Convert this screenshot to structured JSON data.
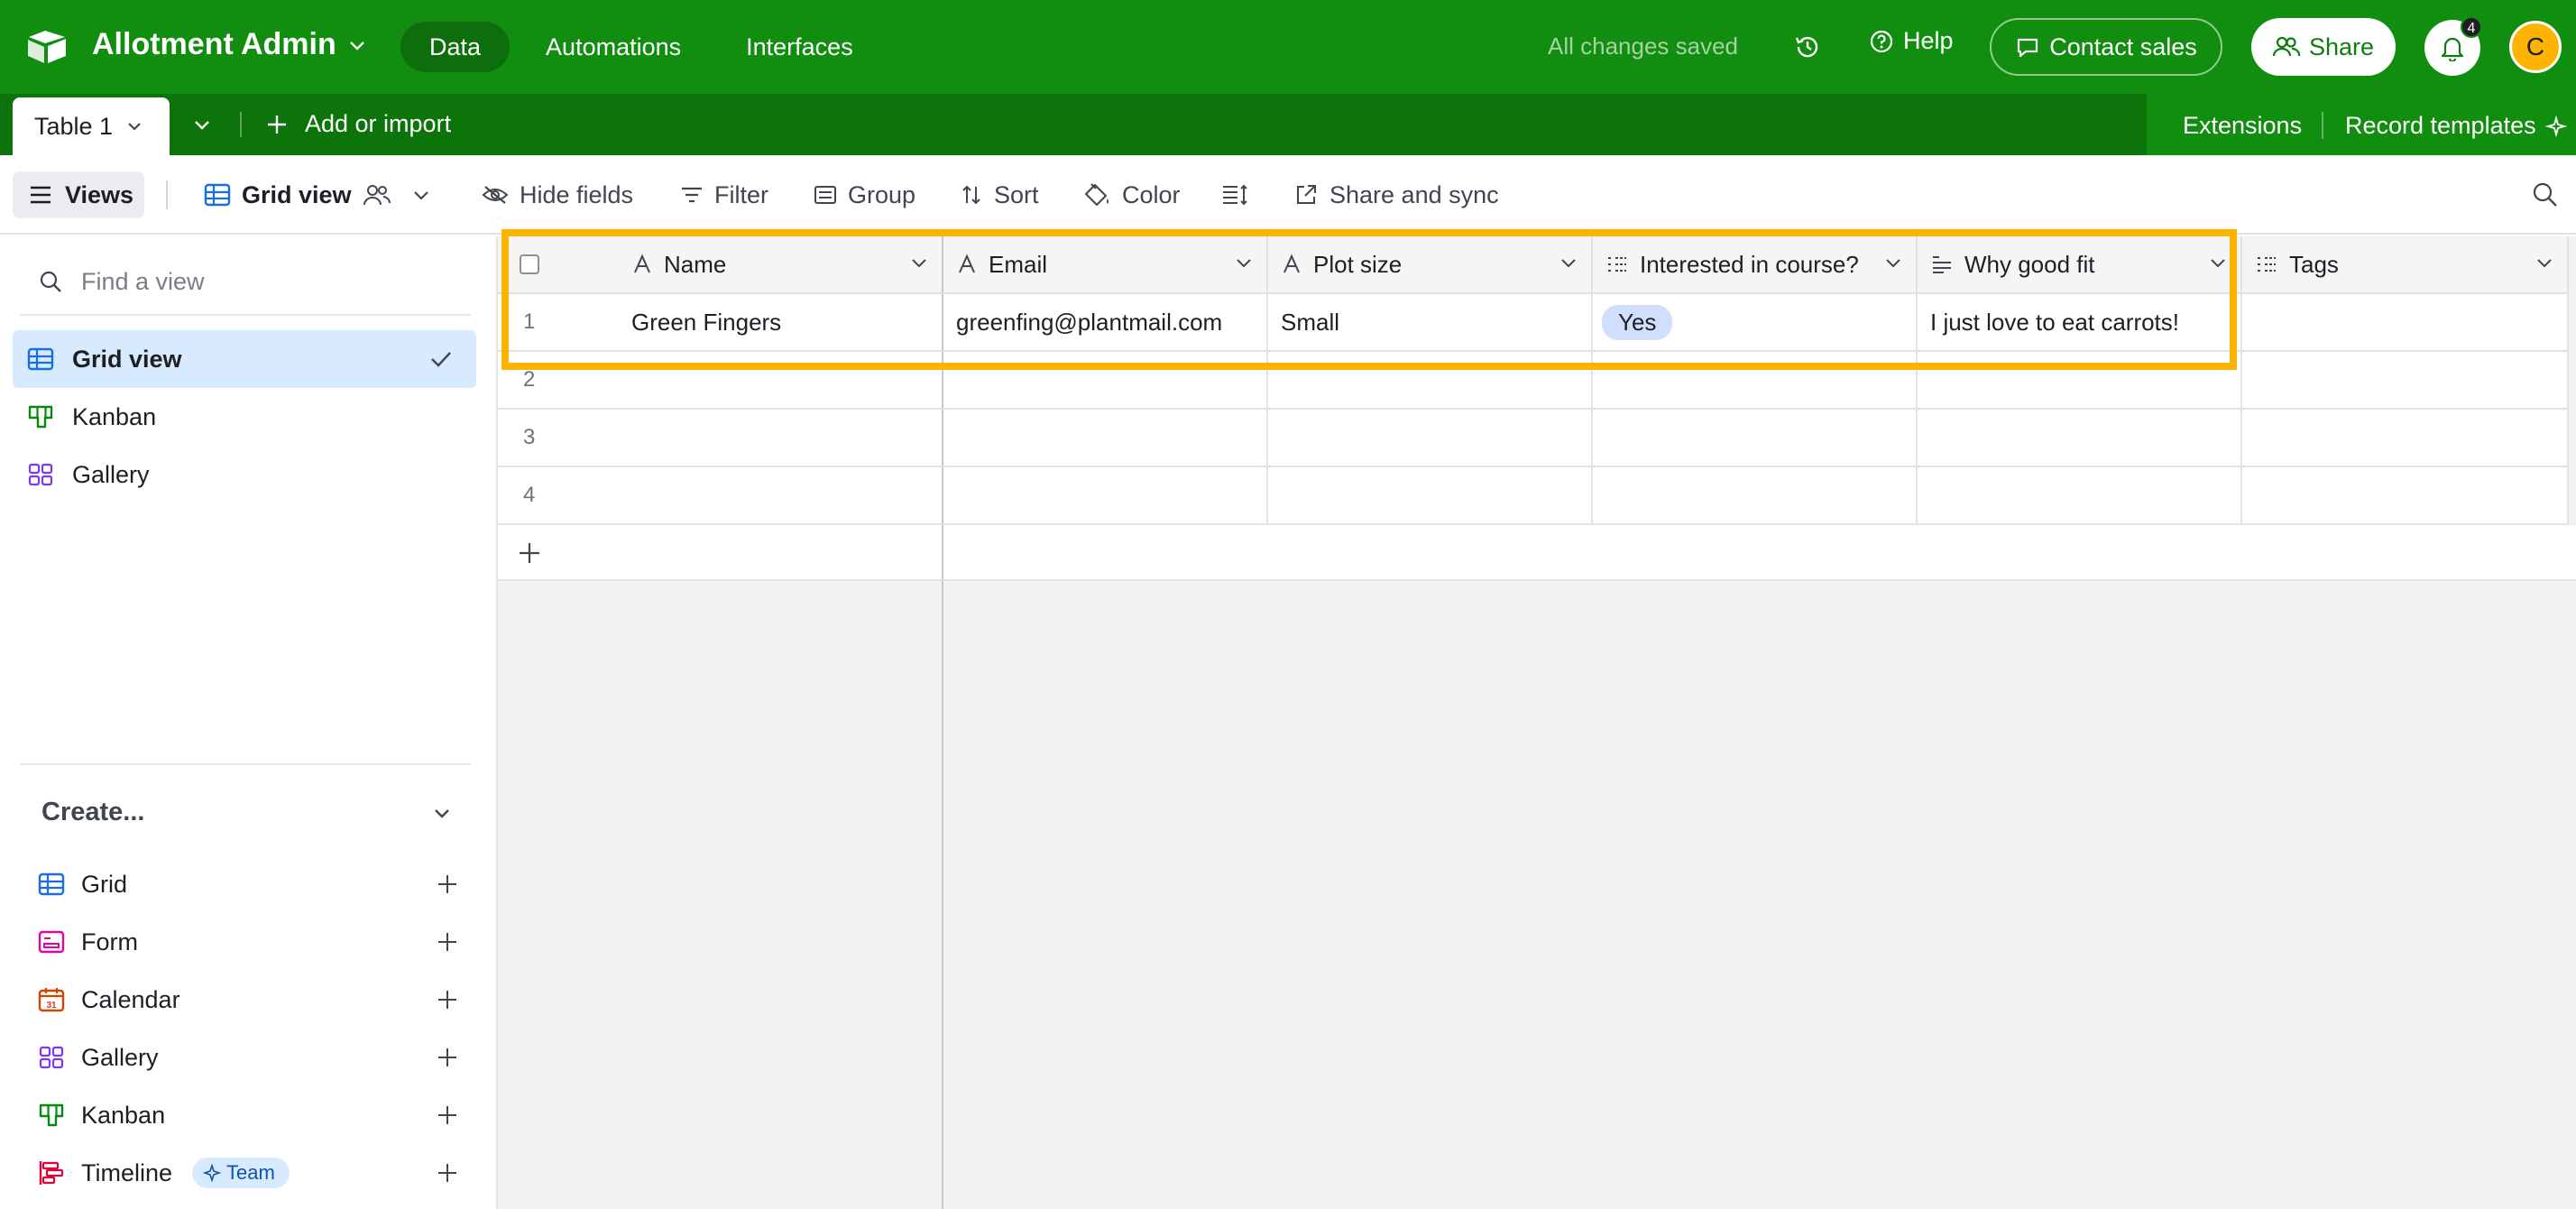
{
  "topbar": {
    "base_name": "Allotment Admin",
    "nav": [
      "Data",
      "Automations",
      "Interfaces"
    ],
    "active_nav": "Data",
    "save_status": "All changes saved",
    "help_label": "Help",
    "contact_label": "Contact sales",
    "share_label": "Share",
    "notification_count": "4",
    "avatar_initial": "C",
    "avatar_color": "#fcb400",
    "brand_color": "#118d0f"
  },
  "tabbar": {
    "table_tab": "Table 1",
    "add_import_label": "Add or import",
    "extensions_label": "Extensions",
    "record_templates_label": "Record templates"
  },
  "viewbar": {
    "views_label": "Views",
    "current_view": "Grid view",
    "hide_fields": "Hide fields",
    "filter": "Filter",
    "group": "Group",
    "sort": "Sort",
    "color": "Color",
    "share_sync": "Share and sync"
  },
  "sidebar": {
    "search_placeholder": "Find a view",
    "views": [
      {
        "label": "Grid view",
        "icon": "grid-icon",
        "active": true
      },
      {
        "label": "Kanban",
        "icon": "kanban-icon"
      },
      {
        "label": "Gallery",
        "icon": "gallery-icon"
      }
    ],
    "create_label": "Create...",
    "create_items": [
      {
        "label": "Grid",
        "icon": "grid-icon"
      },
      {
        "label": "Form",
        "icon": "form-icon"
      },
      {
        "label": "Calendar",
        "icon": "calendar-icon"
      },
      {
        "label": "Gallery",
        "icon": "gallery-icon"
      },
      {
        "label": "Kanban",
        "icon": "kanban-icon"
      },
      {
        "label": "Timeline",
        "icon": "timeline-icon",
        "badge": "Team"
      }
    ]
  },
  "grid": {
    "columns": [
      {
        "label": "Name",
        "icon": "text-icon"
      },
      {
        "label": "Email",
        "icon": "text-icon"
      },
      {
        "label": "Plot size",
        "icon": "text-icon"
      },
      {
        "label": "Interested in course?",
        "icon": "select-icon"
      },
      {
        "label": "Why good fit",
        "icon": "long-text-icon"
      },
      {
        "label": "Tags",
        "icon": "select-icon"
      }
    ],
    "row_numbers": [
      "1",
      "2",
      "3",
      "4"
    ],
    "rows": [
      {
        "name": "Green Fingers",
        "email": "greenfing@plantmail.com",
        "plot_size": "Small",
        "interested": "Yes",
        "why": "I just love to eat carrots!",
        "tags": ""
      }
    ],
    "highlight_color": "#fcb400"
  }
}
